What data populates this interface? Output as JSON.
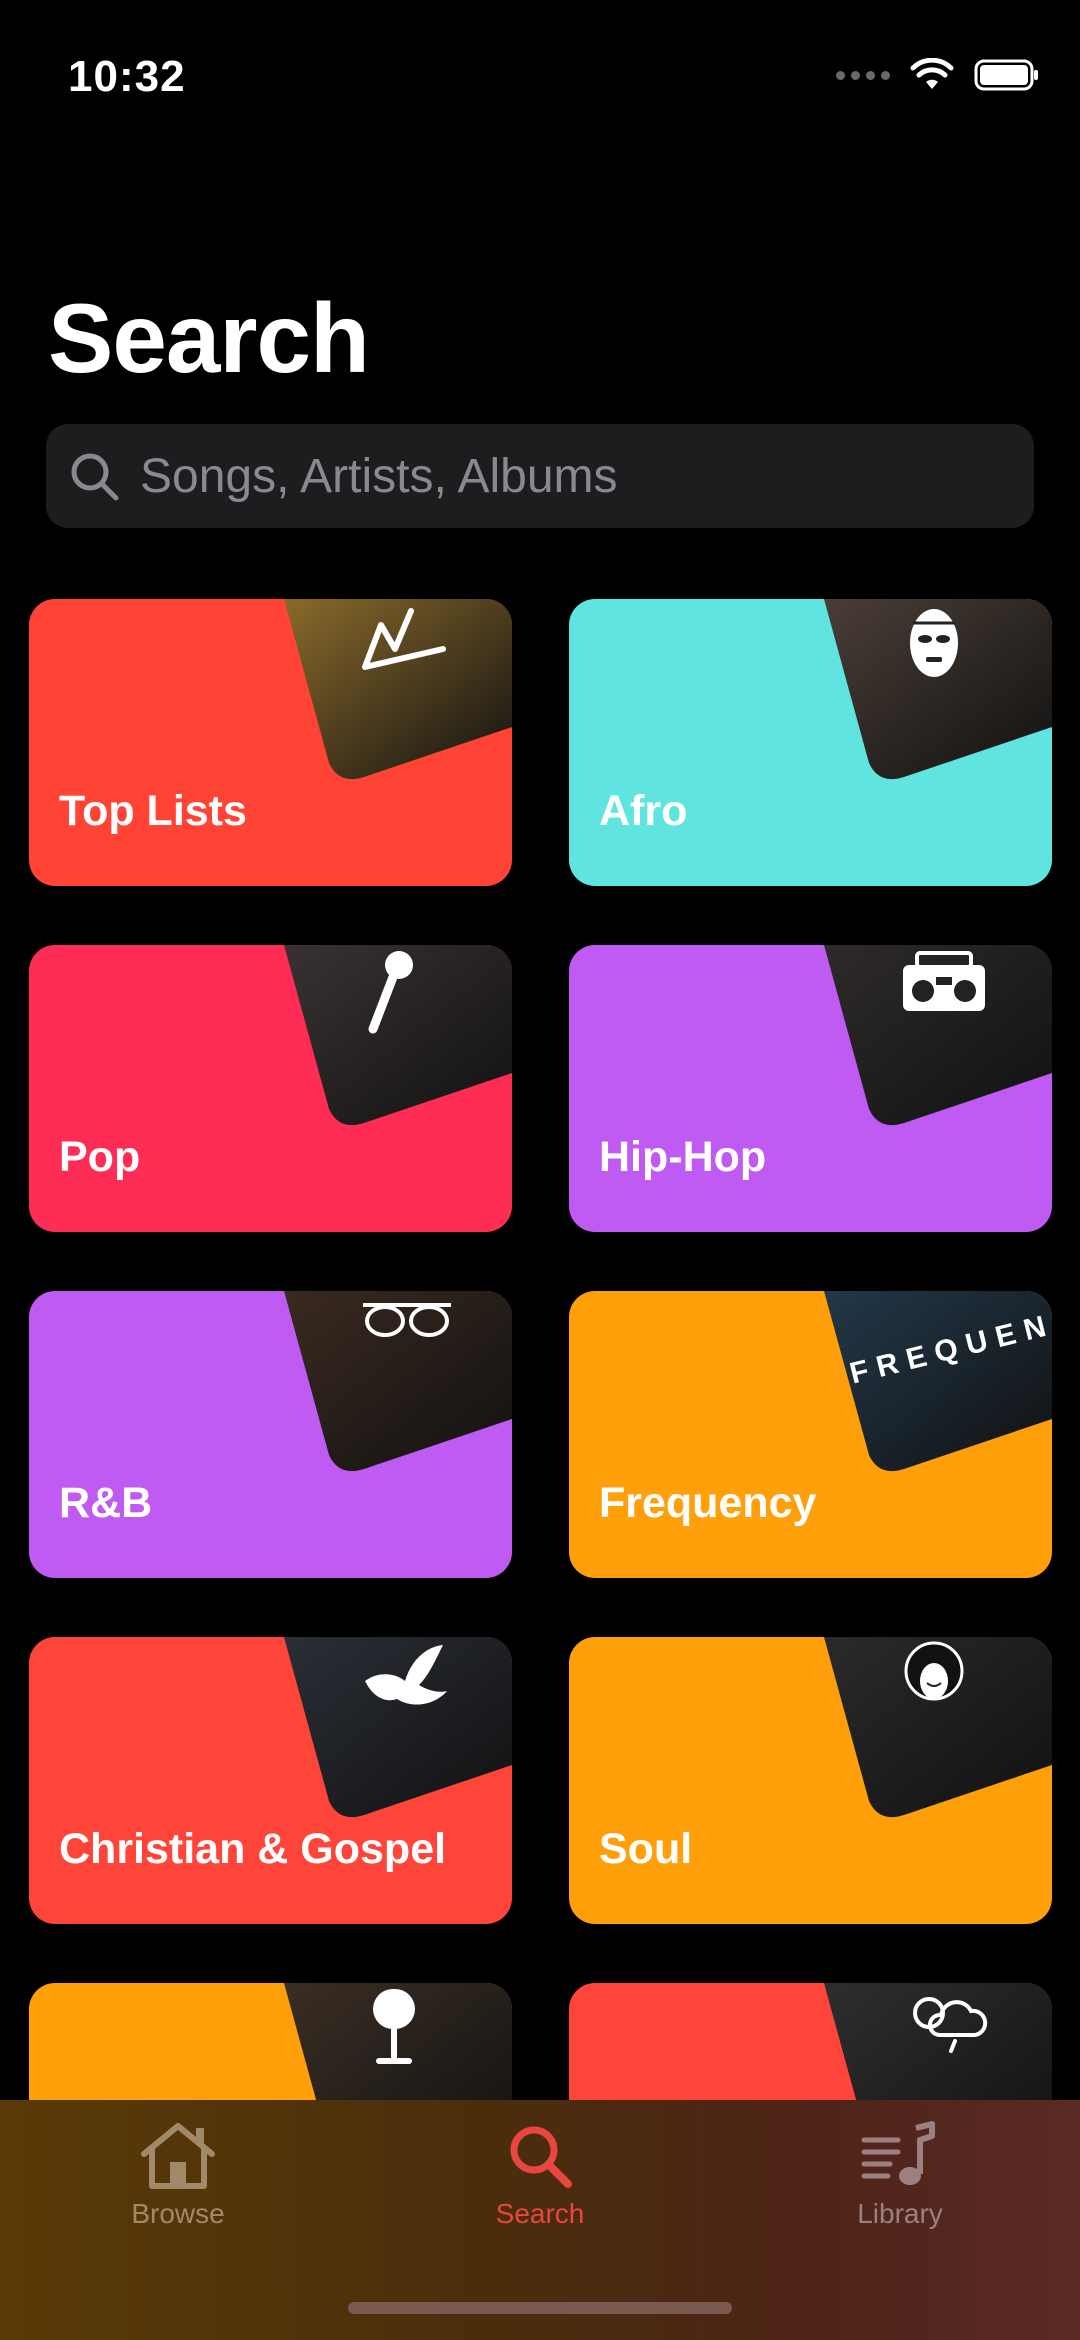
{
  "status_bar": {
    "time": "10:32"
  },
  "page": {
    "title": "Search"
  },
  "search": {
    "placeholder": "Songs, Artists, Albums"
  },
  "genres": [
    {
      "label": "Top Lists",
      "color": "#ff4435",
      "icon": "chart-line-icon",
      "photo_tone": "#8a6a2a"
    },
    {
      "label": "Afro",
      "color": "#5fe4df",
      "icon": "mask-icon",
      "photo_tone": "#4a3e36"
    },
    {
      "label": "Pop",
      "color": "#ff2d55",
      "icon": "microphone-icon",
      "photo_tone": "#3a3232"
    },
    {
      "label": "Hip-Hop",
      "color": "#bf5af2",
      "icon": "boombox-icon",
      "photo_tone": "#2e2a2a"
    },
    {
      "label": "R&B",
      "color": "#bf5af2",
      "icon": "sunglasses-icon",
      "photo_tone": "#3a2a20"
    },
    {
      "label": "Frequency",
      "color": "#ff9f0a",
      "icon": "frequency-text-icon",
      "photo_tone": "#22384a",
      "icon_text": "FREQUENC"
    },
    {
      "label": "Christian & Gospel",
      "color": "#ff453a",
      "icon": "dove-icon",
      "photo_tone": "#2a2e36"
    },
    {
      "label": "Soul",
      "color": "#ff9f0a",
      "icon": "singer-face-icon",
      "photo_tone": "#2a2a2a"
    },
    {
      "label": "",
      "color": "#ff9f0a",
      "icon": "retro-microphone-icon",
      "photo_tone": "#3a2e24"
    },
    {
      "label": "",
      "color": "#ff453a",
      "icon": "weather-icon",
      "photo_tone": "#2e2e2e"
    }
  ],
  "tab_bar": {
    "tabs": [
      {
        "label": "Browse",
        "icon": "house-icon",
        "active": false
      },
      {
        "label": "Search",
        "icon": "search-icon",
        "active": true
      },
      {
        "label": "Library",
        "icon": "music-library-icon",
        "active": false
      }
    ],
    "active_color": "#e8463f"
  }
}
